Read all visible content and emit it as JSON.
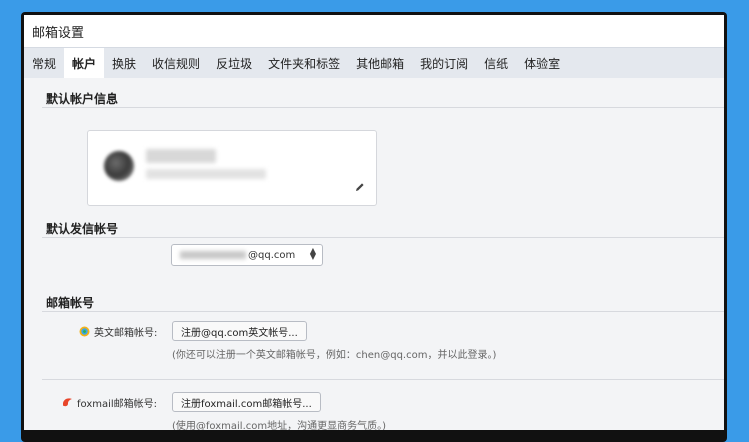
{
  "window": {
    "title": "邮箱设置"
  },
  "tabs": [
    {
      "label": "常规"
    },
    {
      "label": "帐户",
      "active": true
    },
    {
      "label": "换肤"
    },
    {
      "label": "收信规则"
    },
    {
      "label": "反垃圾"
    },
    {
      "label": "文件夹和标签"
    },
    {
      "label": "其他邮箱"
    },
    {
      "label": "我的订阅"
    },
    {
      "label": "信纸"
    },
    {
      "label": "体验室"
    }
  ],
  "default_account": {
    "section_title": "默认帐户信息"
  },
  "default_sender": {
    "section_title": "默认发信帐号",
    "selected_suffix": "@qq.com"
  },
  "mail_accounts": {
    "section_title": "邮箱帐号",
    "english": {
      "label": "英文邮箱帐号:",
      "button": "注册@qq.com英文帐号...",
      "hint": "(你还可以注册一个英文邮箱帐号，例如：chen@qq.com，并以此登录。)"
    },
    "foxmail": {
      "label": "foxmail邮箱帐号:",
      "button": "注册foxmail.com邮箱帐号...",
      "hint": "(使用@foxmail.com地址，沟通更显商务气质。)"
    }
  },
  "colors": {
    "background": "#3a9be8",
    "tabbar": "#e4e8ee",
    "content": "#f3f4f6"
  },
  "icons": [
    "edit-pencil-icon",
    "qq-logo-icon",
    "foxmail-logo-icon",
    "select-arrows-icon"
  ]
}
